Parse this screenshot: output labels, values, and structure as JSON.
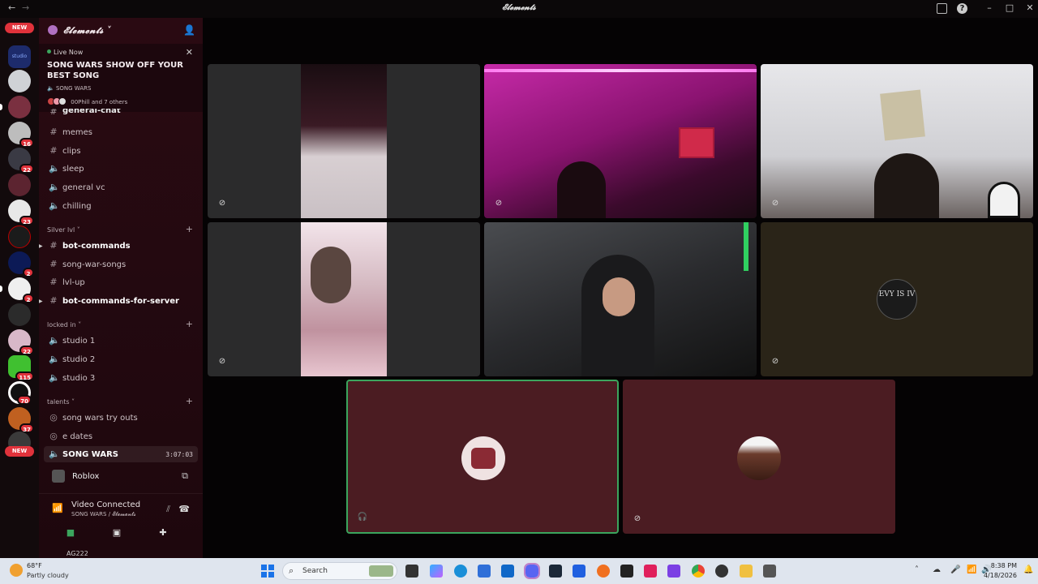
{
  "window": {
    "title": "𝓔𝓵𝓮𝓶𝓮𝓷𝓽𝓼",
    "back_icon": "arrow-left-icon",
    "forward_icon": "arrow-right-icon"
  },
  "server_rail": {
    "new_badge": "NEW",
    "badges": [
      "16",
      "22",
      "23",
      "2",
      "2",
      "22",
      "115",
      "70",
      "37"
    ],
    "bottom_new_badge": "NEW"
  },
  "guild": {
    "name": "𝓔𝓵𝓮𝓶𝓮𝓷𝓽𝓼",
    "chevron": "˅"
  },
  "live": {
    "label": "Live Now",
    "title": "SONG WARS SHOW OFF YOUR BEST SONG",
    "stage": "SONG WARS",
    "people": "00Phill and 7 others"
  },
  "channels": {
    "partial": "general-chat",
    "top": [
      "memes",
      "clips",
      "sleep",
      "general vc",
      "chilling"
    ],
    "cat1": "Silver lvl",
    "cat1_items": [
      "bot-commands",
      "song-war-songs",
      "lvl-up",
      "bot-commands-for-server"
    ],
    "cat2": "locked in",
    "cat2_items": [
      "studio 1",
      "studio 2",
      "studio 3"
    ],
    "cat3": "talents",
    "cat3_items": [
      "song wars try outs",
      "e dates",
      "SONG WARS"
    ],
    "active_time": "3:07:03"
  },
  "activity": {
    "game": "Roblox"
  },
  "voice": {
    "status": "Video Connected",
    "location": "SONG WARS / 𝓔𝓵𝓮𝓶𝓮𝓷𝓽𝓼"
  },
  "user_strip": "AG222",
  "tiles": {
    "avatar_text": "EVY IS IV"
  },
  "taskbar": {
    "temp": "68°F",
    "condition": "Partly cloudy",
    "search_placeholder": "Search",
    "time": "8:38 PM",
    "date": "4/18/2026"
  },
  "colors": {
    "accent": "#3ba55d",
    "badge": "#e0323b",
    "sidebar": "#2a0a12"
  }
}
